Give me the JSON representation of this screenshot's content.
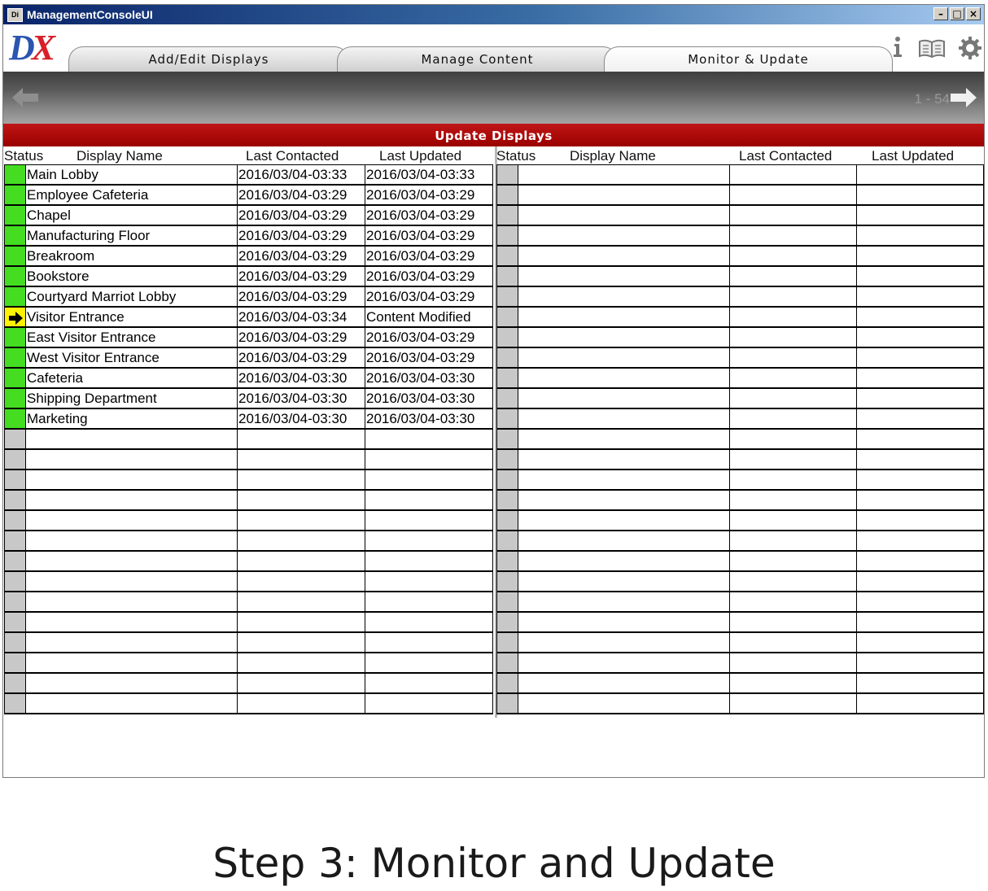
{
  "window": {
    "icon_text": "Di",
    "title": "ManagementConsoleUI"
  },
  "brand": {
    "logo_d": "D",
    "logo_x": "X"
  },
  "tabs": [
    {
      "label": "Add/Edit Displays",
      "active": false
    },
    {
      "label": "Manage Content",
      "active": false
    },
    {
      "label": "Monitor & Update",
      "active": true
    }
  ],
  "header_icons": [
    "info-icon",
    "book-icon",
    "gear-icon"
  ],
  "pager": {
    "range": "1 - 54"
  },
  "section_title": "Update Displays",
  "columns": {
    "status": "Status",
    "display_name": "Display Name",
    "last_contacted": "Last Contacted",
    "last_updated": "Last Updated"
  },
  "left_rows": [
    {
      "status": "ok",
      "name": "Main Lobby",
      "last_contacted": "2016/03/04-03:33",
      "last_updated": "2016/03/04-03:33"
    },
    {
      "status": "ok",
      "name": "Employee Cafeteria",
      "last_contacted": "2016/03/04-03:29",
      "last_updated": "2016/03/04-03:29"
    },
    {
      "status": "ok",
      "name": "Chapel",
      "last_contacted": "2016/03/04-03:29",
      "last_updated": "2016/03/04-03:29"
    },
    {
      "status": "ok",
      "name": "Manufacturing Floor",
      "last_contacted": "2016/03/04-03:29",
      "last_updated": "2016/03/04-03:29"
    },
    {
      "status": "ok",
      "name": "Breakroom",
      "last_contacted": "2016/03/04-03:29",
      "last_updated": "2016/03/04-03:29"
    },
    {
      "status": "ok",
      "name": "Bookstore",
      "last_contacted": "2016/03/04-03:29",
      "last_updated": "2016/03/04-03:29"
    },
    {
      "status": "ok",
      "name": "Courtyard Marriot Lobby",
      "last_contacted": "2016/03/04-03:29",
      "last_updated": "2016/03/04-03:29"
    },
    {
      "status": "updating",
      "name": "Visitor Entrance",
      "last_contacted": "2016/03/04-03:34",
      "last_updated": "Content Modified"
    },
    {
      "status": "ok",
      "name": "East Visitor Entrance",
      "last_contacted": "2016/03/04-03:29",
      "last_updated": "2016/03/04-03:29"
    },
    {
      "status": "ok",
      "name": "West Visitor Entrance",
      "last_contacted": "2016/03/04-03:29",
      "last_updated": "2016/03/04-03:29"
    },
    {
      "status": "ok",
      "name": "Cafeteria",
      "last_contacted": "2016/03/04-03:30",
      "last_updated": "2016/03/04-03:30"
    },
    {
      "status": "ok",
      "name": "Shipping Department",
      "last_contacted": "2016/03/04-03:30",
      "last_updated": "2016/03/04-03:30"
    },
    {
      "status": "ok",
      "name": "Marketing",
      "last_contacted": "2016/03/04-03:30",
      "last_updated": "2016/03/04-03:30"
    }
  ],
  "colors": {
    "status_ok": "#44dd22",
    "status_updating": "#fff200",
    "header_red": "#b00000"
  },
  "caption": "Step 3: Monitor and Update"
}
